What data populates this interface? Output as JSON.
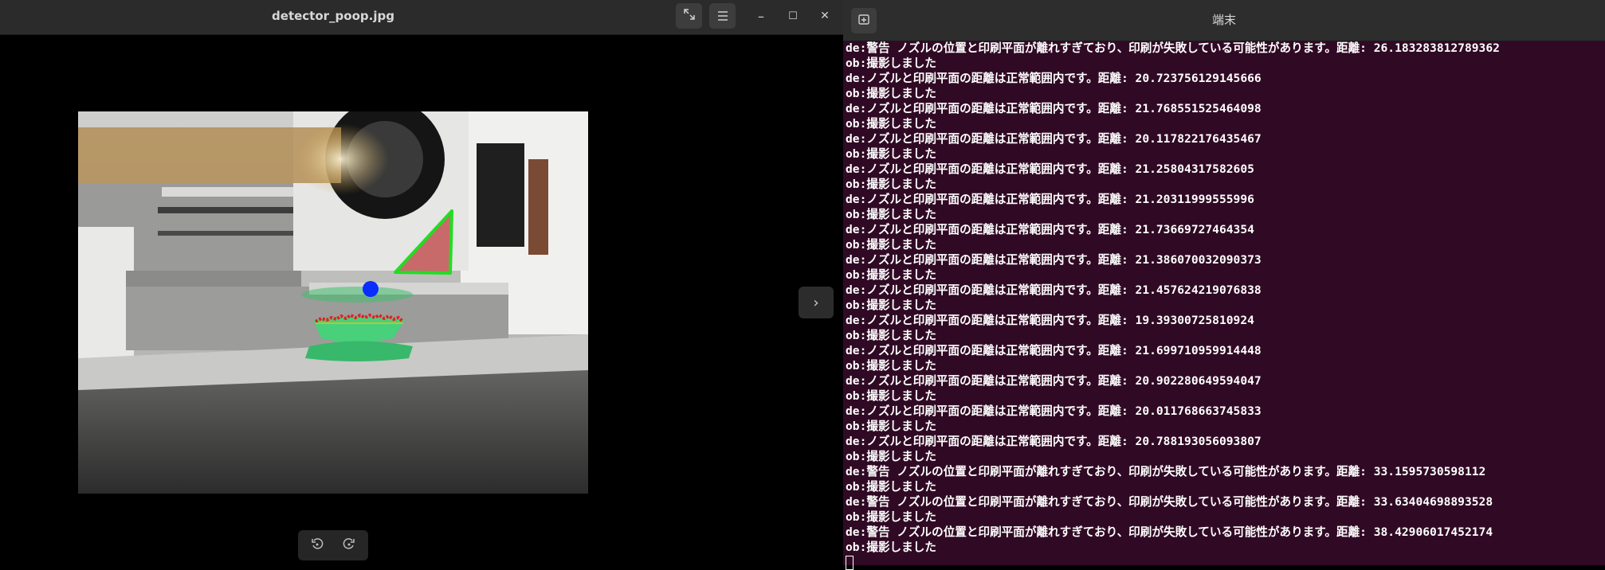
{
  "viewer": {
    "title": "detector_poop.jpg",
    "buttons": {
      "fullscreen": "fullscreen-icon",
      "menu": "hamburger-menu-icon",
      "minimize": "–",
      "maximize": "☐",
      "close": "✕",
      "next": "›",
      "rotate_left": "rotate-left-icon",
      "rotate_right": "rotate-right-icon"
    }
  },
  "terminal": {
    "title": "端末",
    "lines": [
      "de:警告 ノズルの位置と印刷平面が離れすぎており、印刷が失敗している可能性があります。距離: 26.183283812789362",
      "ob:撮影しました",
      "de:ノズルと印刷平面の距離は正常範囲内です。距離: 20.723756129145666",
      "ob:撮影しました",
      "de:ノズルと印刷平面の距離は正常範囲内です。距離: 21.768551525464098",
      "ob:撮影しました",
      "de:ノズルと印刷平面の距離は正常範囲内です。距離: 20.117822176435467",
      "ob:撮影しました",
      "de:ノズルと印刷平面の距離は正常範囲内です。距離: 21.25804317582605",
      "ob:撮影しました",
      "de:ノズルと印刷平面の距離は正常範囲内です。距離: 21.20311999555996",
      "ob:撮影しました",
      "de:ノズルと印刷平面の距離は正常範囲内です。距離: 21.73669727464354",
      "ob:撮影しました",
      "de:ノズルと印刷平面の距離は正常範囲内です。距離: 21.386070032090373",
      "ob:撮影しました",
      "de:ノズルと印刷平面の距離は正常範囲内です。距離: 21.457624219076838",
      "ob:撮影しました",
      "de:ノズルと印刷平面の距離は正常範囲内です。距離: 19.39300725810924",
      "ob:撮影しました",
      "de:ノズルと印刷平面の距離は正常範囲内です。距離: 21.699710959914448",
      "ob:撮影しました",
      "de:ノズルと印刷平面の距離は正常範囲内です。距離: 20.902280649594047",
      "ob:撮影しました",
      "de:ノズルと印刷平面の距離は正常範囲内です。距離: 20.011768663745833",
      "ob:撮影しました",
      "de:ノズルと印刷平面の距離は正常範囲内です。距離: 20.788193056093807",
      "ob:撮影しました",
      "de:警告 ノズルの位置と印刷平面が離れすぎており、印刷が失敗している可能性があります。距離: 33.1595730598112",
      "ob:撮影しました",
      "de:警告 ノズルの位置と印刷平面が離れすぎており、印刷が失敗している可能性があります。距離: 33.63404698893528",
      "ob:撮影しました",
      "de:警告 ノズルの位置と印刷平面が離れすぎており、印刷が失敗している可能性があります。距離: 38.42906017452174",
      "ob:撮影しました"
    ]
  },
  "colors": {
    "terminal_bg": "#300a24",
    "viewer_header_bg": "#2b2b2b",
    "detect_blue": "#0a2cff",
    "detect_green": "#22dd22",
    "detect_red": "#e02020"
  }
}
